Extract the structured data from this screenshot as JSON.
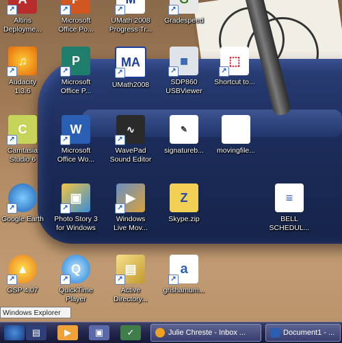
{
  "desktop": {
    "icons": [
      {
        "label": "Altiris\nDeployme...",
        "icon": "altiris-icon"
      },
      {
        "label": "Microsoft\nOffice Po...",
        "icon": "powerpoint-icon"
      },
      {
        "label": "UMath 2008\nProgress Tr...",
        "icon": "umath-progress-icon"
      },
      {
        "label": "Gradespeed",
        "icon": "gradespeed-icon"
      },
      {
        "label": "Audacity\n1.3.6",
        "icon": "audacity-icon"
      },
      {
        "label": "Microsoft\nOffice P...",
        "icon": "publisher-icon"
      },
      {
        "label": "UMath2008",
        "icon": "umath-icon"
      },
      {
        "label": "SDP860\nUSBViewer",
        "icon": "usbviewer-icon"
      },
      {
        "label": "Shortcut to...",
        "icon": "pdf-icon"
      },
      {
        "label": "Camtasia\nStudio 6",
        "icon": "camtasia-icon"
      },
      {
        "label": "Microsoft\nOffice Wo...",
        "icon": "word-icon"
      },
      {
        "label": "WavePad\nSound Editor",
        "icon": "wavepad-icon"
      },
      {
        "label": "signatureb...",
        "icon": "signature-icon"
      },
      {
        "label": "movingfile...",
        "icon": "file-icon"
      },
      {
        "label": "Google Earth",
        "icon": "google-earth-icon"
      },
      {
        "label": "Photo Story 3\nfor Windows",
        "icon": "photo-story-icon"
      },
      {
        "label": "Windows\nLive Mov...",
        "icon": "movie-maker-icon"
      },
      {
        "label": "Skype.zip",
        "icon": "zip-folder-icon"
      },
      {
        "label": "BELL\nSCHEDUL...",
        "icon": "document-icon"
      },
      {
        "label": "GSP 4.07",
        "icon": "gsp-icon"
      },
      {
        "label": "QuickTime\nPlayer",
        "icon": "quicktime-icon"
      },
      {
        "label": "Active\nDirectory...",
        "icon": "active-directory-icon"
      },
      {
        "label": "grishamum...",
        "icon": "text-document-icon"
      }
    ]
  },
  "tooltip": "Windows Explorer",
  "taskbar": {
    "tasks": [
      {
        "label": "Julie Chreste - Inbox ..."
      },
      {
        "label": "Document1 - ..."
      }
    ]
  }
}
